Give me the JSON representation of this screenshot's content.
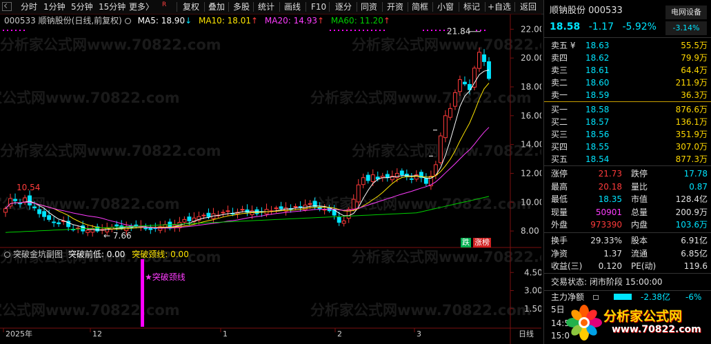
{
  "toolbar": {
    "items": [
      "分时",
      "1分钟",
      "5分钟",
      "15分钟",
      "更多",
      "复权",
      "叠加",
      "多股",
      "统计",
      "画线",
      "F10",
      "逐分",
      "同资",
      "开资",
      "简框",
      "小窗",
      "标记",
      "+自选",
      "返回"
    ],
    "more_arrow": "〉",
    "flag_char": "R"
  },
  "chart": {
    "code": "000533",
    "name": "顺钠股份",
    "period": "(日线,前复权)",
    "ma5_label": "MA5: 18.90",
    "ma5_arrow": "↓",
    "ma10_label": "MA10: 18.01",
    "ma20_label": "MA20: 14.93",
    "ma60_label": "MA60: 11.20",
    "up_arrow": "↑",
    "high_label": "21.84",
    "left_high_label": "10.54",
    "low_label": "7.66",
    "badge_die": "跌",
    "badge_bang": "涨榜",
    "sub_title": "突破金坑副图",
    "sub_breakout_low": "突破前低: 0.00",
    "sub_neckline": "突破颈线: 0.00",
    "sub_mark": "★突破颈线",
    "x_labels": [
      "2025年",
      "12",
      "1",
      "2",
      "3"
    ],
    "x_right": "日线",
    "watermark": "分析家公式网www.70822.com",
    "colors": {
      "up": "#ff3b3b",
      "down": "#00e5ff",
      "ma5": "#ffffff",
      "ma10": "#ffe600",
      "ma20": "#ff3cff",
      "ma60": "#00d000",
      "magenta": "#ff00ff"
    }
  },
  "chart_data": {
    "type": "line",
    "x": [
      "2025年",
      "12",
      "1",
      "2",
      "3"
    ],
    "y_ticks": [
      22.0,
      20.0,
      18.0,
      16.0,
      14.0,
      12.0,
      10.0,
      8.0
    ],
    "ylim": [
      7.0,
      22.4
    ],
    "series": [
      {
        "name": "MA5",
        "value": 18.9
      },
      {
        "name": "MA10",
        "value": 18.01
      },
      {
        "name": "MA20",
        "value": 14.93
      },
      {
        "name": "MA60",
        "value": 11.2
      }
    ],
    "annotations": {
      "high": 21.84,
      "left_high": 10.54,
      "low": 7.66
    },
    "sub": {
      "y_ticks": [
        4.5,
        3.0,
        1.5
      ],
      "ylim": [
        0,
        5.6
      ],
      "bar_value": 5.6
    }
  },
  "quote": {
    "name": "顺钠股份",
    "code": "000533",
    "sector": "电网设备",
    "price": "18.58",
    "change": "-1.17",
    "change_pct": "-5.92%",
    "sector_pct": "-3.14%",
    "asks": [
      {
        "label": "卖五",
        "mark": "¥",
        "price": "18.63",
        "vol": "55.5万"
      },
      {
        "label": "卖四",
        "mark": "",
        "price": "18.62",
        "vol": "79.9万"
      },
      {
        "label": "卖三",
        "mark": "",
        "price": "18.61",
        "vol": "64.4万"
      },
      {
        "label": "卖二",
        "mark": "",
        "price": "18.60",
        "vol": "211.9万"
      },
      {
        "label": "卖一",
        "mark": "",
        "price": "18.59",
        "vol": "36.3万"
      }
    ],
    "bids": [
      {
        "label": "买一",
        "price": "18.58",
        "vol": "876.6万"
      },
      {
        "label": "买二",
        "price": "18.57",
        "vol": "136.1万"
      },
      {
        "label": "买三",
        "price": "18.56",
        "vol": "351.9万"
      },
      {
        "label": "买四",
        "price": "18.55",
        "vol": "307.0万"
      },
      {
        "label": "买五",
        "price": "18.54",
        "vol": "877.3万"
      }
    ],
    "stats": [
      {
        "l1": "涨停",
        "v1": "21.73",
        "c1": "#ff3b3b",
        "l2": "跌停",
        "v2": "17.78",
        "c2": "#00e5ff"
      },
      {
        "l1": "最高",
        "v1": "20.18",
        "c1": "#ff3b3b",
        "l2": "量比",
        "v2": "0.87",
        "c2": "#00e5ff"
      },
      {
        "l1": "最低",
        "v1": "18.35",
        "c1": "#00e5ff",
        "l2": "市值",
        "v2": "128.4亿",
        "c2": "#e0e0e0"
      },
      {
        "l1": "现量",
        "v1": "50901",
        "c1": "#ff3cff",
        "l2": "总量",
        "v2": "200.9万",
        "c2": "#e0e0e0"
      },
      {
        "l1": "外盘",
        "v1": "973390",
        "c1": "#ff3b3b",
        "l2": "内盘",
        "v2": "103.6万",
        "c2": "#00e5ff"
      }
    ],
    "stats2": [
      {
        "l1": "换手",
        "v1": "29.33%",
        "l2": "股本",
        "v2": "6.91亿"
      },
      {
        "l1": "净资",
        "v1": "1.37",
        "l2": "流通",
        "v2": "6.85亿"
      },
      {
        "l1": "收益(三)",
        "v1": "0.120",
        "l2": "PE(动)",
        "v2": "119.6"
      }
    ],
    "trade_status": "交易状态: 闭市阶段 15:00:00",
    "main_flow_label": "主力净额",
    "main_flow_value": "-2.38亿",
    "main_flow_pct": "-6%",
    "day_label": "5日",
    "time_1": "14:5",
    "time_2": "15:0",
    "logo_text": "分析家公式网",
    "logo_url": "www.70822.com"
  }
}
